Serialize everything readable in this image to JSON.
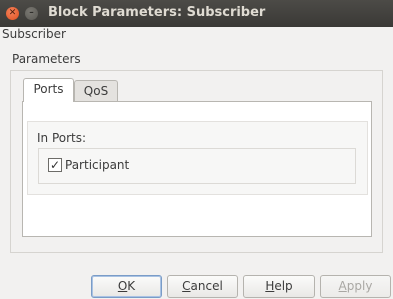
{
  "window": {
    "title": "Block Parameters: Subscriber",
    "controls": {
      "close_glyph": "✕",
      "minimize_glyph": "–"
    }
  },
  "dialog": {
    "block_name": "Subscriber",
    "group_label": "Parameters",
    "tabs": [
      {
        "label": "Ports",
        "active": true
      },
      {
        "label": "QoS",
        "active": false
      }
    ],
    "ports_tab": {
      "section_label": "In Ports:",
      "checkbox": {
        "label": "Participant",
        "checked": true,
        "glyph": "✓"
      }
    }
  },
  "buttons": {
    "ok": {
      "mnemonic": "O",
      "rest": "K"
    },
    "cancel": {
      "mnemonic": "C",
      "rest": "ancel"
    },
    "help": {
      "mnemonic": "H",
      "rest": "elp"
    },
    "apply": {
      "mnemonic": "A",
      "rest": "pply",
      "enabled": false
    }
  }
}
